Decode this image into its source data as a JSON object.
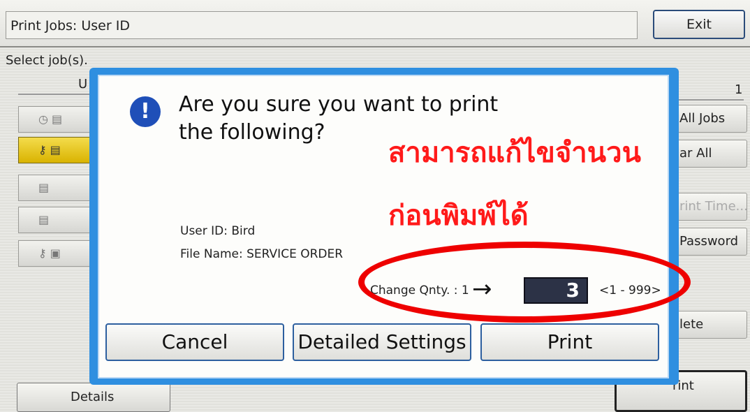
{
  "header": {
    "title": "Print Jobs: User ID",
    "exit_label": "Exit"
  },
  "list": {
    "select_label": "Select job(s).",
    "column_header_left": "U",
    "column_header_right": "1"
  },
  "side_buttons": {
    "all_jobs": "All Jobs",
    "clear_all": "ar All",
    "print_time": "rint Time...",
    "password": "Password",
    "delete": "lete"
  },
  "footer": {
    "details": "Details",
    "print": "rint"
  },
  "dialog": {
    "question": "Are you sure you want to print the following?",
    "user_id": "User ID: Bird",
    "file_name": "File Name: SERVICE ORDER",
    "change_qty_label": "Change Qnty. : 1",
    "new_qty": "3",
    "qty_range": "<1 - 999>",
    "buttons": {
      "cancel": "Cancel",
      "detailed": "Detailed Settings",
      "print": "Print"
    }
  },
  "annotation": {
    "line1": "สามารถแก้ไขจำนวน",
    "line2": "ก่อนพิมพ์ได้",
    "color": "#ff1a1a",
    "ellipse_color": "#ee0000"
  }
}
